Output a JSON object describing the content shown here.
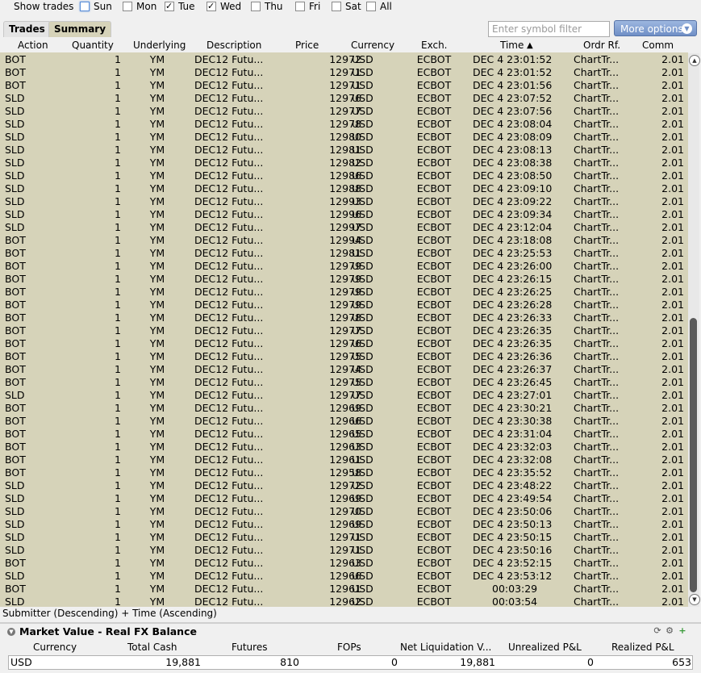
{
  "show_trades": {
    "label": "Show trades",
    "days": [
      {
        "label": "Sun",
        "checked": false
      },
      {
        "label": "Mon",
        "checked": false
      },
      {
        "label": "Tue",
        "checked": true
      },
      {
        "label": "Wed",
        "checked": true
      },
      {
        "label": "Thu",
        "checked": false
      },
      {
        "label": "Fri",
        "checked": false
      },
      {
        "label": "Sat",
        "checked": false
      },
      {
        "label": "All",
        "checked": false
      }
    ]
  },
  "tabs": [
    {
      "label": "Trades"
    },
    {
      "label": "Summary"
    }
  ],
  "filter": {
    "placeholder": "Enter symbol filter"
  },
  "more_options": {
    "label": "More options"
  },
  "columns": [
    "Action",
    "Quantity",
    "Underlying",
    "Description",
    "Price",
    "Currency",
    "Exch.",
    "Time",
    "Ordr Rf.",
    "Comm"
  ],
  "rows": [
    [
      "BOT",
      "1",
      "YM",
      "DEC12 Futu...",
      "12972",
      "USD",
      "ECBOT",
      "DEC 4 23:01:52",
      "ChartTr...",
      "2.01"
    ],
    [
      "BOT",
      "1",
      "YM",
      "DEC12 Futu...",
      "12971",
      "USD",
      "ECBOT",
      "DEC 4 23:01:52",
      "ChartTr...",
      "2.01"
    ],
    [
      "BOT",
      "1",
      "YM",
      "DEC12 Futu...",
      "12971",
      "USD",
      "ECBOT",
      "DEC 4 23:01:56",
      "ChartTr...",
      "2.01"
    ],
    [
      "SLD",
      "1",
      "YM",
      "DEC12 Futu...",
      "12976",
      "USD",
      "ECBOT",
      "DEC 4 23:07:52",
      "ChartTr...",
      "2.01"
    ],
    [
      "SLD",
      "1",
      "YM",
      "DEC12 Futu...",
      "12977",
      "USD",
      "ECBOT",
      "DEC 4 23:07:56",
      "ChartTr...",
      "2.01"
    ],
    [
      "SLD",
      "1",
      "YM",
      "DEC12 Futu...",
      "12978",
      "USD",
      "ECBOT",
      "DEC 4 23:08:04",
      "ChartTr...",
      "2.01"
    ],
    [
      "SLD",
      "1",
      "YM",
      "DEC12 Futu...",
      "12980",
      "USD",
      "ECBOT",
      "DEC 4 23:08:09",
      "ChartTr...",
      "2.01"
    ],
    [
      "SLD",
      "1",
      "YM",
      "DEC12 Futu...",
      "12981",
      "USD",
      "ECBOT",
      "DEC 4 23:08:13",
      "ChartTr...",
      "2.01"
    ],
    [
      "SLD",
      "1",
      "YM",
      "DEC12 Futu...",
      "12982",
      "USD",
      "ECBOT",
      "DEC 4 23:08:38",
      "ChartTr...",
      "2.01"
    ],
    [
      "SLD",
      "1",
      "YM",
      "DEC12 Futu...",
      "12986",
      "USD",
      "ECBOT",
      "DEC 4 23:08:50",
      "ChartTr...",
      "2.01"
    ],
    [
      "SLD",
      "1",
      "YM",
      "DEC12 Futu...",
      "12988",
      "USD",
      "ECBOT",
      "DEC 4 23:09:10",
      "ChartTr...",
      "2.01"
    ],
    [
      "SLD",
      "1",
      "YM",
      "DEC12 Futu...",
      "12993",
      "USD",
      "ECBOT",
      "DEC 4 23:09:22",
      "ChartTr...",
      "2.01"
    ],
    [
      "SLD",
      "1",
      "YM",
      "DEC12 Futu...",
      "12996",
      "USD",
      "ECBOT",
      "DEC 4 23:09:34",
      "ChartTr...",
      "2.01"
    ],
    [
      "SLD",
      "1",
      "YM",
      "DEC12 Futu...",
      "12997",
      "USD",
      "ECBOT",
      "DEC 4 23:12:04",
      "ChartTr...",
      "2.01"
    ],
    [
      "BOT",
      "1",
      "YM",
      "DEC12 Futu...",
      "12994",
      "USD",
      "ECBOT",
      "DEC 4 23:18:08",
      "ChartTr...",
      "2.01"
    ],
    [
      "BOT",
      "1",
      "YM",
      "DEC12 Futu...",
      "12981",
      "USD",
      "ECBOT",
      "DEC 4 23:25:53",
      "ChartTr...",
      "2.01"
    ],
    [
      "BOT",
      "1",
      "YM",
      "DEC12 Futu...",
      "12979",
      "USD",
      "ECBOT",
      "DEC 4 23:26:00",
      "ChartTr...",
      "2.01"
    ],
    [
      "BOT",
      "1",
      "YM",
      "DEC12 Futu...",
      "12979",
      "USD",
      "ECBOT",
      "DEC 4 23:26:15",
      "ChartTr...",
      "2.01"
    ],
    [
      "BOT",
      "1",
      "YM",
      "DEC12 Futu...",
      "12979",
      "USD",
      "ECBOT",
      "DEC 4 23:26:25",
      "ChartTr...",
      "2.01"
    ],
    [
      "BOT",
      "1",
      "YM",
      "DEC12 Futu...",
      "12979",
      "USD",
      "ECBOT",
      "DEC 4 23:26:28",
      "ChartTr...",
      "2.01"
    ],
    [
      "BOT",
      "1",
      "YM",
      "DEC12 Futu...",
      "12978",
      "USD",
      "ECBOT",
      "DEC 4 23:26:33",
      "ChartTr...",
      "2.01"
    ],
    [
      "BOT",
      "1",
      "YM",
      "DEC12 Futu...",
      "12977",
      "USD",
      "ECBOT",
      "DEC 4 23:26:35",
      "ChartTr...",
      "2.01"
    ],
    [
      "BOT",
      "1",
      "YM",
      "DEC12 Futu...",
      "12976",
      "USD",
      "ECBOT",
      "DEC 4 23:26:35",
      "ChartTr...",
      "2.01"
    ],
    [
      "BOT",
      "1",
      "YM",
      "DEC12 Futu...",
      "12975",
      "USD",
      "ECBOT",
      "DEC 4 23:26:36",
      "ChartTr...",
      "2.01"
    ],
    [
      "BOT",
      "1",
      "YM",
      "DEC12 Futu...",
      "12974",
      "USD",
      "ECBOT",
      "DEC 4 23:26:37",
      "ChartTr...",
      "2.01"
    ],
    [
      "BOT",
      "1",
      "YM",
      "DEC12 Futu...",
      "12975",
      "USD",
      "ECBOT",
      "DEC 4 23:26:45",
      "ChartTr...",
      "2.01"
    ],
    [
      "SLD",
      "1",
      "YM",
      "DEC12 Futu...",
      "12977",
      "USD",
      "ECBOT",
      "DEC 4 23:27:01",
      "ChartTr...",
      "2.01"
    ],
    [
      "BOT",
      "1",
      "YM",
      "DEC12 Futu...",
      "12969",
      "USD",
      "ECBOT",
      "DEC 4 23:30:21",
      "ChartTr...",
      "2.01"
    ],
    [
      "BOT",
      "1",
      "YM",
      "DEC12 Futu...",
      "12966",
      "USD",
      "ECBOT",
      "DEC 4 23:30:38",
      "ChartTr...",
      "2.01"
    ],
    [
      "BOT",
      "1",
      "YM",
      "DEC12 Futu...",
      "12965",
      "USD",
      "ECBOT",
      "DEC 4 23:31:04",
      "ChartTr...",
      "2.01"
    ],
    [
      "BOT",
      "1",
      "YM",
      "DEC12 Futu...",
      "12963",
      "USD",
      "ECBOT",
      "DEC 4 23:32:03",
      "ChartTr...",
      "2.01"
    ],
    [
      "BOT",
      "1",
      "YM",
      "DEC12 Futu...",
      "12961",
      "USD",
      "ECBOT",
      "DEC 4 23:32:08",
      "ChartTr...",
      "2.01"
    ],
    [
      "BOT",
      "1",
      "YM",
      "DEC12 Futu...",
      "12958",
      "USD",
      "ECBOT",
      "DEC 4 23:35:52",
      "ChartTr...",
      "2.01"
    ],
    [
      "SLD",
      "1",
      "YM",
      "DEC12 Futu...",
      "12972",
      "USD",
      "ECBOT",
      "DEC 4 23:48:22",
      "ChartTr...",
      "2.01"
    ],
    [
      "SLD",
      "1",
      "YM",
      "DEC12 Futu...",
      "12969",
      "USD",
      "ECBOT",
      "DEC 4 23:49:54",
      "ChartTr...",
      "2.01"
    ],
    [
      "SLD",
      "1",
      "YM",
      "DEC12 Futu...",
      "12970",
      "USD",
      "ECBOT",
      "DEC 4 23:50:06",
      "ChartTr...",
      "2.01"
    ],
    [
      "SLD",
      "1",
      "YM",
      "DEC12 Futu...",
      "12969",
      "USD",
      "ECBOT",
      "DEC 4 23:50:13",
      "ChartTr...",
      "2.01"
    ],
    [
      "SLD",
      "1",
      "YM",
      "DEC12 Futu...",
      "12971",
      "USD",
      "ECBOT",
      "DEC 4 23:50:15",
      "ChartTr...",
      "2.01"
    ],
    [
      "SLD",
      "1",
      "YM",
      "DEC12 Futu...",
      "12971",
      "USD",
      "ECBOT",
      "DEC 4 23:50:16",
      "ChartTr...",
      "2.01"
    ],
    [
      "BOT",
      "1",
      "YM",
      "DEC12 Futu...",
      "12963",
      "USD",
      "ECBOT",
      "DEC 4 23:52:15",
      "ChartTr...",
      "2.01"
    ],
    [
      "SLD",
      "1",
      "YM",
      "DEC12 Futu...",
      "12966",
      "USD",
      "ECBOT",
      "DEC 4 23:53:12",
      "ChartTr...",
      "2.01"
    ],
    [
      "BOT",
      "1",
      "YM",
      "DEC12 Futu...",
      "12961",
      "USD",
      "ECBOT",
      "00:03:29",
      "ChartTr...",
      "2.01"
    ],
    [
      "SLD",
      "1",
      "YM",
      "DEC12 Futu...",
      "12962",
      "USD",
      "ECBOT",
      "00:03:54",
      "ChartTr...",
      "2.01"
    ]
  ],
  "sort_info": "Submitter (Descending)  +  Time (Ascending)",
  "market_value": {
    "title": "Market Value - Real FX Balance",
    "columns": [
      "Currency",
      "Total Cash",
      "Futures",
      "FOPs",
      "Net Liquidation V...",
      "Unrealized P&L",
      "Realized P&L"
    ],
    "row": [
      "USD",
      "19,881",
      "810",
      "0",
      "19,881",
      "0",
      "653"
    ]
  }
}
